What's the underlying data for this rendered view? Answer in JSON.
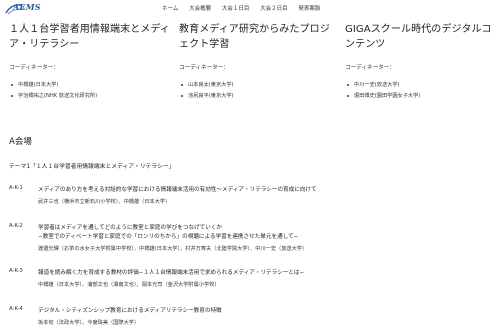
{
  "header": {
    "logo_text": "AEMS",
    "nav": [
      "ホーム",
      "大会概要",
      "大会１日目",
      "大会２日目",
      "発表案脈"
    ]
  },
  "sessions": [
    {
      "title_line1": "１人１台学習者用情報端末とメディ",
      "title_line2": "ア・リテラシー",
      "coordinator_label": "コーディネーター：",
      "members": [
        "中橋雄(日本大学)",
        "宇治橋祐之(NHK 放送文化研究所)"
      ]
    },
    {
      "title_line1": "教育メディア研究からみたプロジ",
      "title_line2": "ェクト学習",
      "coordinator_label": "コーディネーター：",
      "members": [
        "山本良太(東京大学)",
        "池尻良平(東京大学)"
      ]
    },
    {
      "title_line1": "GIGAスクール時代のデジタルコ",
      "title_line2": "ンテンツ",
      "coordinator_label": "コーディネーター：",
      "members": [
        "中川一史(放送大学)",
        "堀田博史(園田学園女子大学)"
      ]
    }
  ],
  "venue": "A会場",
  "theme": "テーマ1「１人１台学習者用情報端末とメディア・リテラシー」",
  "talks": [
    {
      "id": "A-K-1",
      "title": "メディアのあり方を考える対話的な学習における情報端末活用の有効性〜メディア・リテラシーの育成に向けて",
      "subtitle": "",
      "authors": "武井三也（横浜市立新石川小学校）、中橋雄（日本大学）"
    },
    {
      "id": "A-K-2",
      "title": "学習者はメディアを通してどのように教室と家庭の学びをつなげていくか",
      "subtitle": "−教室でのディベート学習と家庭での「ロンリのちから」の視聴による学習を連携させた単元を通して−",
      "authors": "渡邊光輝（お茶の水女子大学附属中学校）、中橋雄(日本大学）、村井万寿夫（北陸学院大学）、中川一史（放送大学）"
    },
    {
      "id": "A-K-3",
      "title": "報道を読み解く力を育成する教材の評価−１人１台情報端末活用で求められるメディア・リテラシーとは−",
      "subtitle": "",
      "authors": "中橋雄（日本大学）、浦部文也（湘南文也）、岡本光司（金沢大学附属小学校）"
    },
    {
      "id": "A-K-4",
      "title": "デジタル・シティズンシップ教育におけるメディアリテラシー教育の特徴",
      "subtitle": "",
      "authors": "坂本旬（法政大学）、今度珠美（国際大学）"
    }
  ]
}
